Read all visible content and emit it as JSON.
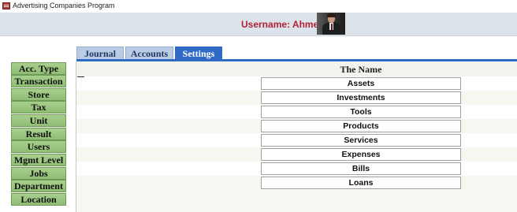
{
  "window": {
    "title": "Advertising Companies Program"
  },
  "header": {
    "username_label": "Username: Ahmed"
  },
  "tabs": [
    {
      "label": "Journal",
      "active": false
    },
    {
      "label": "Accounts",
      "active": false
    },
    {
      "label": "Settings",
      "active": true
    }
  ],
  "sidebar": {
    "items": [
      {
        "label": "Acc. Type"
      },
      {
        "label": "Transaction"
      },
      {
        "label": "Store"
      },
      {
        "label": "Tax"
      },
      {
        "label": "Unit"
      },
      {
        "label": "Result"
      },
      {
        "label": "Users"
      },
      {
        "label": "Mgmt Level"
      },
      {
        "label": "Jobs"
      },
      {
        "label": "Department"
      },
      {
        "label": "Location"
      }
    ]
  },
  "main": {
    "column_header": "The Name",
    "rows": [
      {
        "name": "Assets"
      },
      {
        "name": "Investments"
      },
      {
        "name": "Tools"
      },
      {
        "name": "Products"
      },
      {
        "name": "Services"
      },
      {
        "name": "Expenses"
      },
      {
        "name": "Bills"
      },
      {
        "name": "Loans"
      }
    ]
  },
  "colors": {
    "accent": "#2f6bc4",
    "username_text": "#b32134",
    "nav_button": "#9cc67f",
    "inactive_tab": "#b9cbe5"
  }
}
